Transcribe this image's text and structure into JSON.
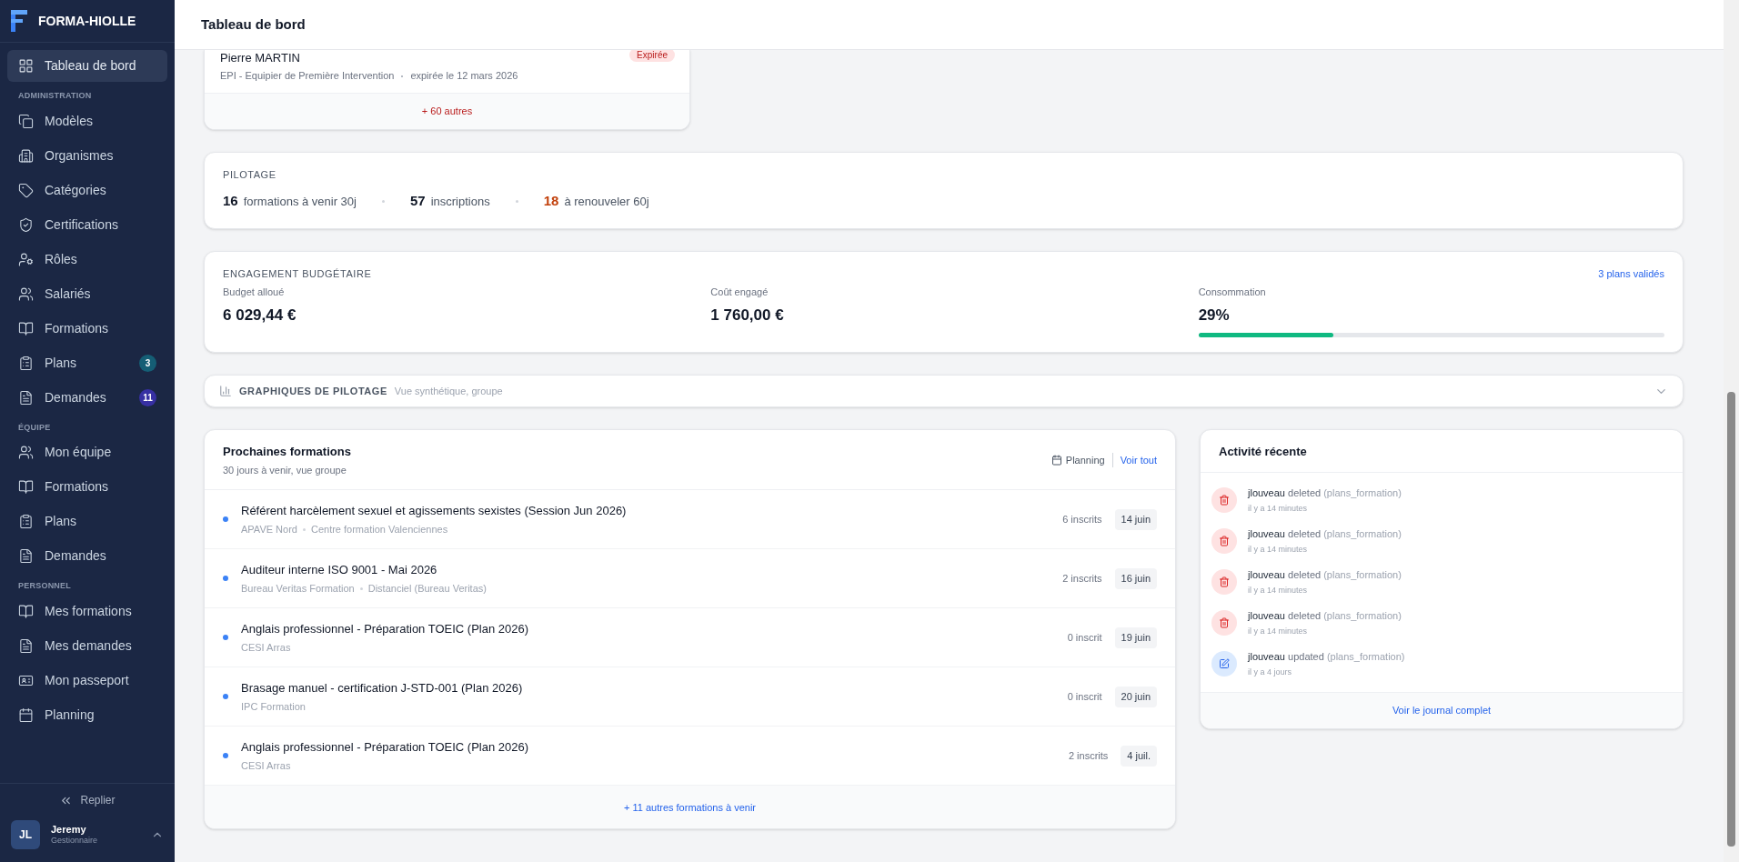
{
  "sidebar": {
    "brand": "FORMA-HIOLLE",
    "sections": [
      {
        "items": [
          {
            "label": "Tableau de bord",
            "kind": "grid",
            "selected": true
          }
        ]
      },
      {
        "label": "ADMINISTRATION",
        "items": [
          {
            "label": "Modèles",
            "kind": "copy",
            "selected": false
          },
          {
            "label": "Organismes",
            "kind": "building",
            "selected": false
          },
          {
            "label": "Catégories",
            "kind": "tag",
            "selected": false
          },
          {
            "label": "Certifications",
            "kind": "shield",
            "selected": false
          },
          {
            "label": "Rôles",
            "kind": "user-cog",
            "selected": false
          },
          {
            "label": "Salariés",
            "kind": "users",
            "selected": false
          },
          {
            "label": "Formations",
            "kind": "book",
            "selected": false
          },
          {
            "label": "Plans",
            "kind": "clipboard",
            "selected": false,
            "badge": "3",
            "color": "#155e75"
          },
          {
            "label": "Demandes",
            "kind": "file",
            "selected": false,
            "badge": "11",
            "color": "#3730a3"
          }
        ]
      },
      {
        "label": "ÉQUIPE",
        "items": [
          {
            "label": "Mon équipe",
            "kind": "users",
            "selected": false
          },
          {
            "label": "Formations",
            "kind": "book",
            "selected": false
          },
          {
            "label": "Plans",
            "kind": "clipboard",
            "selected": false
          },
          {
            "label": "Demandes",
            "kind": "file",
            "selected": false
          }
        ]
      },
      {
        "label": "PERSONNEL",
        "items": [
          {
            "label": "Mes formations",
            "kind": "book",
            "selected": false
          },
          {
            "label": "Mes demandes",
            "kind": "file",
            "selected": false
          },
          {
            "label": "Mon passeport",
            "kind": "id-card",
            "selected": false
          },
          {
            "label": "Planning",
            "kind": "calendar",
            "selected": false
          }
        ]
      }
    ],
    "collapse": "Replier",
    "user": {
      "initials": "JL",
      "name": "Jeremy",
      "role": "Gestionnaire"
    }
  },
  "header": {
    "title": "Tableau de bord"
  },
  "expired_card": {
    "name": "Pierre MARTIN",
    "badge": "Expirée",
    "course": "EPI - Equipier de Première Intervention",
    "expiry": "expirée le 12 mars 2026",
    "more": "+ 60 autres"
  },
  "pilotage": {
    "title": "PILOTAGE",
    "stats": [
      {
        "value": "16",
        "label": "formations à venir 30j",
        "kind": "normal"
      },
      {
        "value": "57",
        "label": "inscriptions",
        "kind": "normal"
      },
      {
        "value": "18",
        "label": "à renouveler 60j",
        "kind": "alert"
      }
    ]
  },
  "budget": {
    "title": "ENGAGEMENT BUDGÉTAIRE",
    "link": "3 plans validés",
    "metrics": [
      {
        "label": "Budget alloué",
        "value": "6 029,44 €"
      },
      {
        "label": "Coût engagé",
        "value": "1 760,00 €"
      }
    ],
    "consumption": {
      "label": "Consommation",
      "value": "29%",
      "level": 0.29
    }
  },
  "charts": {
    "title": "GRAPHIQUES DE PILOTAGE",
    "subtitle": "Vue synthétique, groupe",
    "expanded": false
  },
  "upcoming": {
    "title": "Prochaines formations",
    "subtitle": "30 jours à venir, vue groupe",
    "planning": "Planning",
    "view_all": "Voir tout",
    "rows": [
      {
        "title": "Référent harcèlement sexuel et agissements sexistes (Session Jun 2026)",
        "org": "APAVE Nord",
        "place": "Centre formation Valenciennes",
        "count": "6 inscrits",
        "date": "14 juin"
      },
      {
        "title": "Auditeur interne ISO 9001 - Mai 2026",
        "org": "Bureau Veritas Formation",
        "place": "Distanciel (Bureau Veritas)",
        "count": "2 inscrits",
        "date": "16 juin"
      },
      {
        "title": "Anglais professionnel - Préparation TOEIC (Plan 2026)",
        "org": "CESI Arras",
        "count": "0 inscrit",
        "date": "19 juin"
      },
      {
        "title": "Brasage manuel - certification J-STD-001 (Plan 2026)",
        "org": "IPC Formation",
        "count": "0 inscrit",
        "date": "20 juin"
      },
      {
        "title": "Anglais professionnel - Préparation TOEIC (Plan 2026)",
        "org": "CESI Arras",
        "count": "2 inscrits",
        "date": "4 juil."
      }
    ],
    "more": "+ 11 autres formations à venir"
  },
  "activity": {
    "title": "Activité récente",
    "items": [
      {
        "user": "jlouveau",
        "action": "deleted",
        "object": "(plans_formation)",
        "time": "il y a 14 minutes",
        "kind": "delete"
      },
      {
        "user": "jlouveau",
        "action": "deleted",
        "object": "(plans_formation)",
        "time": "il y a 14 minutes",
        "kind": "delete"
      },
      {
        "user": "jlouveau",
        "action": "deleted",
        "object": "(plans_formation)",
        "time": "il y a 14 minutes",
        "kind": "delete"
      },
      {
        "user": "jlouveau",
        "action": "deleted",
        "object": "(plans_formation)",
        "time": "il y a 14 minutes",
        "kind": "delete"
      },
      {
        "user": "jlouveau",
        "action": "updated",
        "object": "(plans_formation)",
        "time": "il y a 4 jours",
        "kind": "update"
      }
    ],
    "footer": "Voir le journal complet"
  }
}
